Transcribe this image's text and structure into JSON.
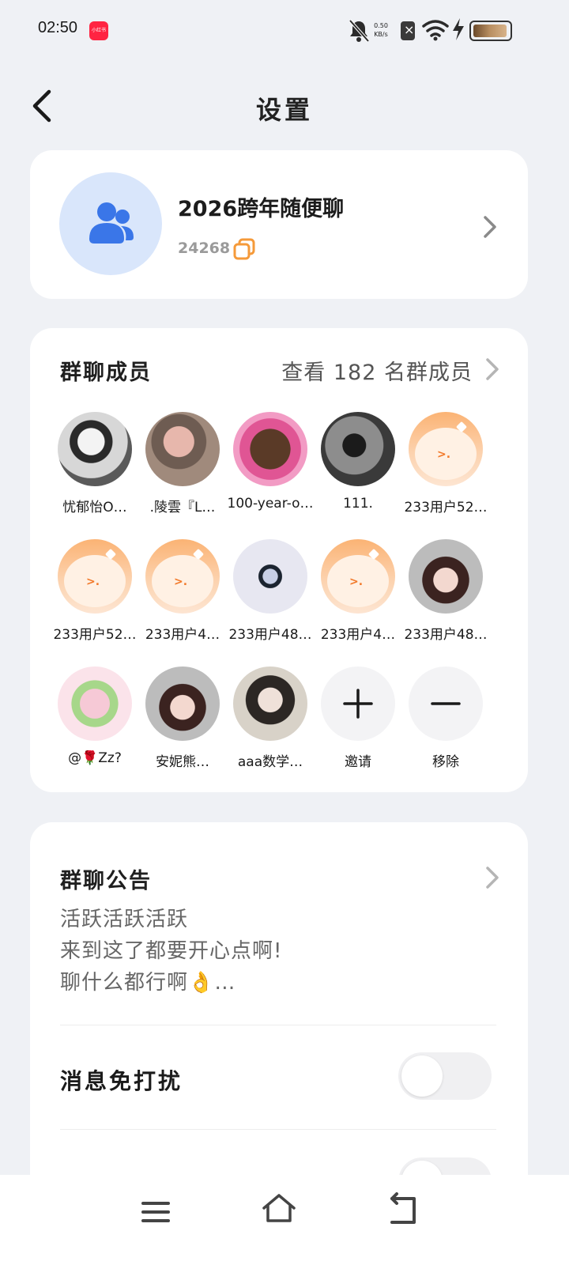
{
  "status_bar": {
    "time": "02:50",
    "app_badge": "小红书",
    "net_speed_value": "0.50",
    "net_speed_unit": "KB/s"
  },
  "header": {
    "title": "设置",
    "back_icon": "chevron-left-icon"
  },
  "group": {
    "name": "2026跨年随便聊",
    "id": "24268",
    "avatar_icon": "group-people-icon",
    "accent": "#3a76e8"
  },
  "members": {
    "title": "群聊成员",
    "view_all": "查看 182 名群成员",
    "list": [
      {
        "name": "忧郁怡O…"
      },
      {
        "name": ".陵雲『L…"
      },
      {
        "name": "100-year-o…"
      },
      {
        "name": "111."
      },
      {
        "name": "233用户52…"
      },
      {
        "name": "233用户52…"
      },
      {
        "name": "233用户4…"
      },
      {
        "name": "233用户48…"
      },
      {
        "name": "233用户4…"
      },
      {
        "name": "233用户48…"
      },
      {
        "name": "@🌹Zz?"
      },
      {
        "name": "安妮熊…"
      },
      {
        "name": "aaa数学…"
      }
    ],
    "invite_label": "邀请",
    "remove_label": "移除"
  },
  "notice": {
    "title": "群聊公告",
    "lines": [
      "活跃活跃活跃",
      "来到这了都要开心点啊!",
      "聊什么都行啊👌…"
    ]
  },
  "settings": {
    "mute_label": "消息免打扰",
    "mute_on": false,
    "second_toggle_on": false
  },
  "nav": {
    "menu_icon": "menu-icon",
    "home_icon": "home-icon",
    "back_icon": "back-icon"
  },
  "colors": {
    "background": "#eff1f5",
    "card": "#ffffff",
    "copy_accent": "#f59a3a"
  }
}
